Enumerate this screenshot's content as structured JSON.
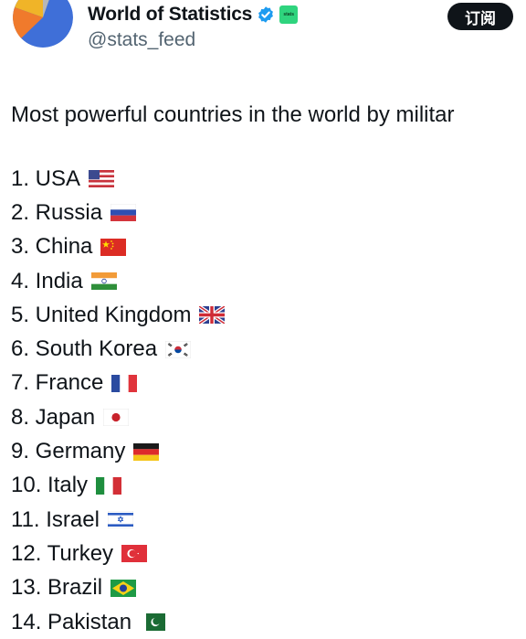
{
  "header": {
    "display_name": "World of Statistics",
    "handle": "@stats_feed",
    "subscribe_label": "订阅",
    "affiliation_badge_text": "stats",
    "avatar_icon": "pie-chart-icon"
  },
  "tweet": {
    "text": "Most powerful countries in the world by militar",
    "rankings": [
      {
        "label": "1. USA",
        "flag": "usa-flag-icon"
      },
      {
        "label": "2. Russia",
        "flag": "russia-flag-icon"
      },
      {
        "label": "3. China",
        "flag": "china-flag-icon"
      },
      {
        "label": "4. India",
        "flag": "india-flag-icon"
      },
      {
        "label": "5. United Kingdom",
        "flag": "uk-flag-icon"
      },
      {
        "label": "6. South Korea",
        "flag": "south-korea-flag-icon"
      },
      {
        "label": "7. France",
        "flag": "france-flag-icon"
      },
      {
        "label": "8. Japan",
        "flag": "japan-flag-icon"
      },
      {
        "label": "9. Germany",
        "flag": "germany-flag-icon"
      },
      {
        "label": "10. Italy",
        "flag": "italy-flag-icon"
      },
      {
        "label": "11. Israel",
        "flag": "israel-flag-icon"
      },
      {
        "label": "12. Turkey",
        "flag": "turkey-flag-icon"
      },
      {
        "label": "13. Brazil",
        "flag": "brazil-flag-icon"
      },
      {
        "label": "14. Pakistan",
        "flag": "pakistan-flag-icon"
      }
    ]
  },
  "colors": {
    "verified_blue": "#1d9bf0",
    "affiliation_green": "#2fd47e",
    "subscribe_bg": "#0f1419",
    "handle_gray": "#536471"
  }
}
